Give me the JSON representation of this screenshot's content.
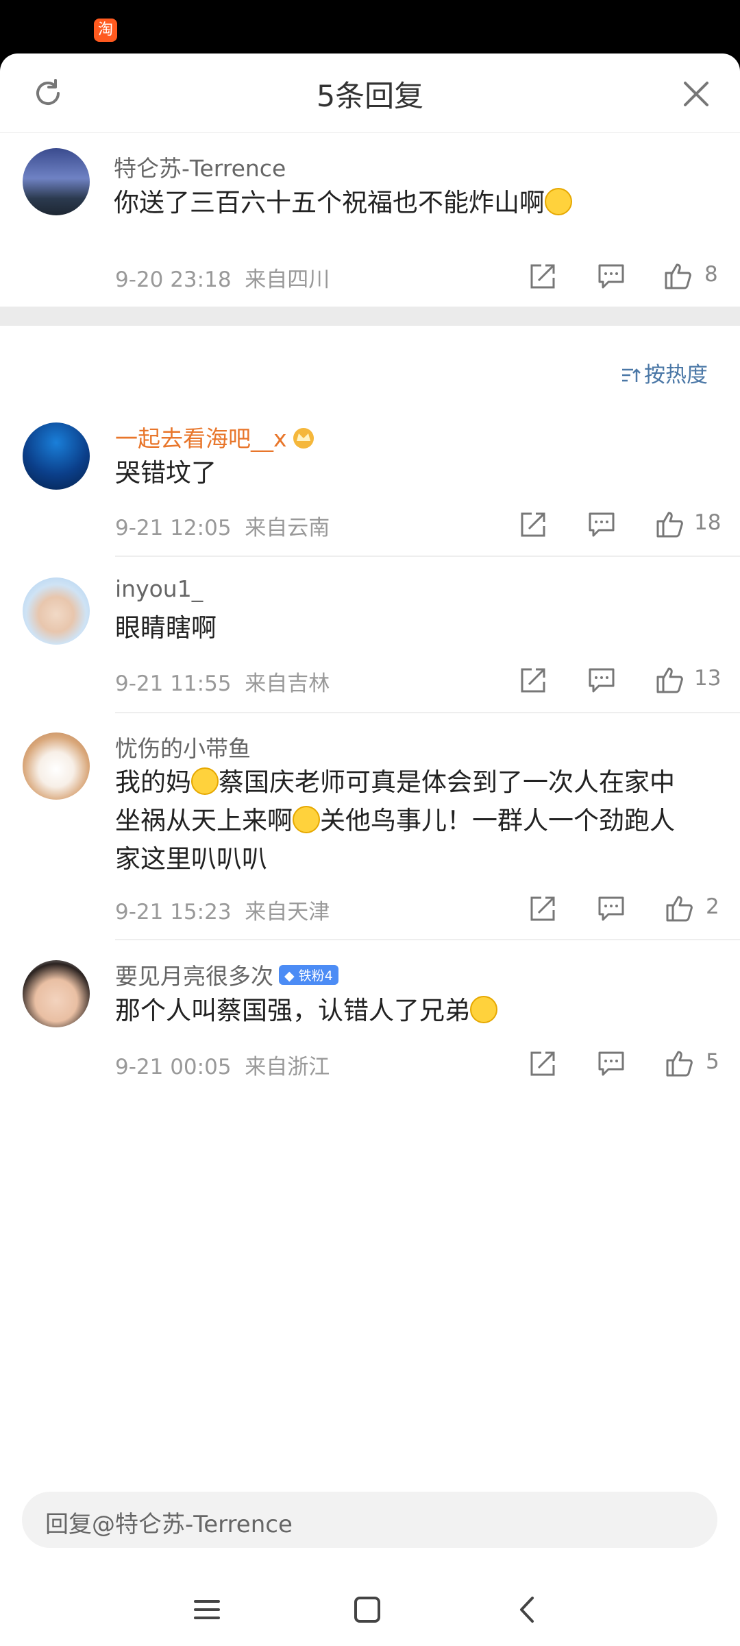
{
  "status_bar": {
    "app_icon_label": "淘"
  },
  "header": {
    "title": "5条回复"
  },
  "root_comment": {
    "username": "特仑苏-Terrence",
    "text": "你送了三百六十五个祝福也不能炸山啊",
    "time": "9-20 23:18",
    "location": "来自四川",
    "likes": "8"
  },
  "sort": {
    "label": "按热度"
  },
  "replies": [
    {
      "username": "一起去看海吧__x",
      "text_lines": [
        "哭错坟了"
      ],
      "time": "9-21 12:05",
      "location": "来自云南",
      "likes": "18"
    },
    {
      "username": "inyou1_",
      "text_lines": [
        "眼睛瞎啊"
      ],
      "time": "9-21 11:55",
      "location": "来自吉林",
      "likes": "13"
    },
    {
      "username": "忧伤的小带鱼",
      "text_lines": [
        "我的妈",
        "蔡国庆老师可真是体会到了一次人在家中",
        "坐祸从天上来啊",
        "关他鸟事儿！一群人一个劲跑人",
        "家这里叭叭叭"
      ],
      "time": "9-21 15:23",
      "location": "来自天津",
      "likes": "2"
    },
    {
      "username": "要见月亮很多次",
      "badge": "铁粉4",
      "text_lines": [
        "那个人叫蔡国强，认错人了兄弟"
      ],
      "time": "9-21 00:05",
      "location": "来自浙江",
      "likes": "5"
    }
  ],
  "reply_input": {
    "placeholder": "回复@特仑苏-Terrence"
  },
  "colors": {
    "accent": "#4a77a6",
    "vip_name": "#e8762b",
    "fan_badge": "#4c8cf5"
  }
}
